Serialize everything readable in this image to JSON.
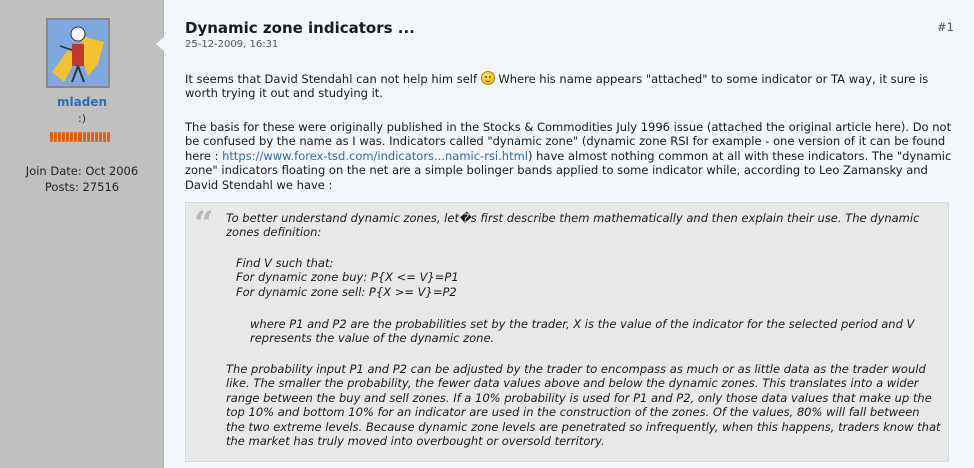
{
  "user": {
    "name": "mladen",
    "title": ":)",
    "join_date": "Join Date: Oct 2006",
    "posts": "Posts: 27516",
    "rep_color": "#e06010"
  },
  "post": {
    "title": "Dynamic zone indicators ...",
    "date": "25-12-2009, 16:31",
    "number": "#1",
    "p1_before": "It seems that David Stendahl can not help him self ",
    "smiley_icon": "smiley-icon",
    "p1_after": " Where his name appears \"attached\" to some indicator or TA way, it sure is worth trying it out and studying it.",
    "p2_before": "The basis for these were originally published in the Stocks & Commodities July 1996 issue (attached the original article here). Do not be confused by the name as I was. Indicators called \"dynamic zone\" (dynamic zone RSI for example - one version of it can be found here : ",
    "p2_link": "https://www.forex-tsd.com/indicators...namic-rsi.html",
    "p2_after": ") have almost nothing common at all with these indicators. The \"dynamic zone\" indicators floating on the net are a simple bolinger bands applied to some indicator while, according to Leo Zamansky and David Stendahl we have :"
  },
  "quote": {
    "q1": "To better understand dynamic zones, let�s first describe them mathematically and then explain their use. The dynamic zones definition:",
    "q2_line1": "Find V such that:",
    "q2_line2": "For dynamic zone buy: P{X <= V}=P1",
    "q2_line3": "For dynamic zone sell: P{X >= V}=P2",
    "q3": "where P1 and P2 are the probabilities set by the trader, X is the value of the indicator for the selected period and V represents the value of the dynamic zone.",
    "q4": "The probability input P1 and P2 can be adjusted by the trader to encompass as much or as little data as the trader would like. The smaller the probability, the fewer data values above and below the dynamic zones. This translates into a wider range between the buy and sell zones. If a 10% probability is used for P1 and P2, only those data values that make up the top 10% and bottom 10% for an indicator are used in the construction of the zones. Of the values, 80% will fall between the two extreme levels. Because dynamic zone levels are penetrated so infrequently, when this happens, traders know that the market has truly moved into overbought or oversold territory."
  }
}
